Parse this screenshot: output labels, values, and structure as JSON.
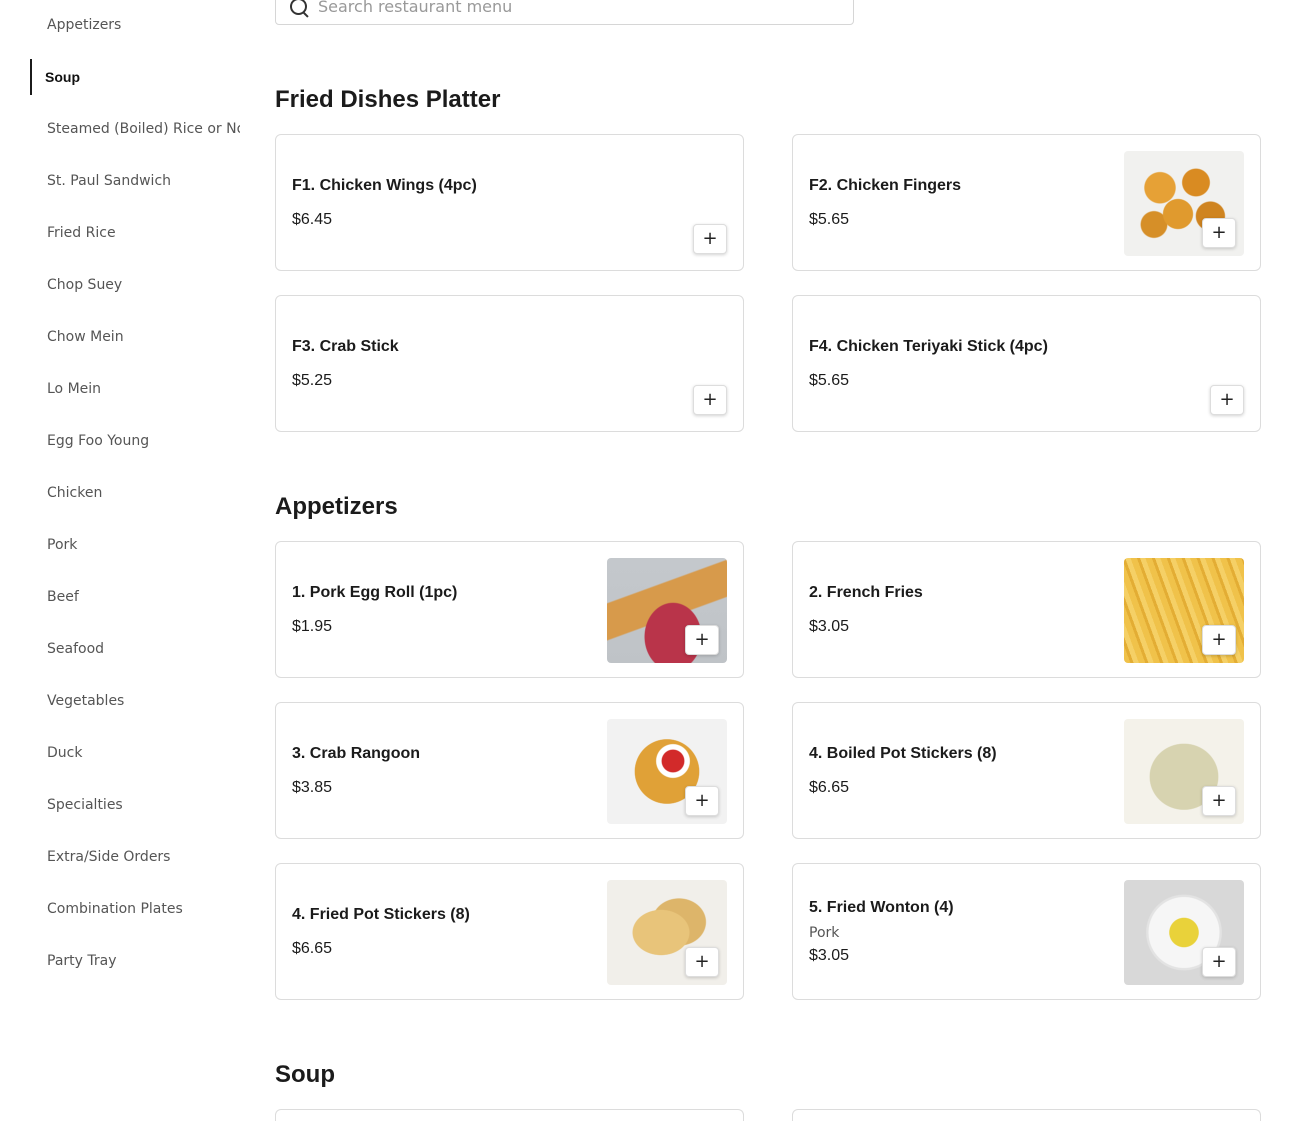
{
  "search": {
    "placeholder": "Search restaurant menu"
  },
  "sidebar": {
    "items": [
      {
        "label": "Appetizers"
      },
      {
        "label": "Soup"
      },
      {
        "label": "Steamed (Boiled) Rice or Noodles"
      },
      {
        "label": "St. Paul Sandwich"
      },
      {
        "label": "Fried Rice"
      },
      {
        "label": "Chop Suey"
      },
      {
        "label": "Chow Mein"
      },
      {
        "label": "Lo Mein"
      },
      {
        "label": "Egg Foo Young"
      },
      {
        "label": "Chicken"
      },
      {
        "label": "Pork"
      },
      {
        "label": "Beef"
      },
      {
        "label": "Seafood"
      },
      {
        "label": "Vegetables"
      },
      {
        "label": "Duck"
      },
      {
        "label": "Specialties"
      },
      {
        "label": "Extra/Side Orders"
      },
      {
        "label": "Combination Plates"
      },
      {
        "label": "Party Tray"
      }
    ],
    "active": "Soup"
  },
  "sections": {
    "fried": {
      "title": "Fried Dishes Platter",
      "items": [
        {
          "name": "F1. Chicken Wings (4pc)",
          "price": "$6.45"
        },
        {
          "name": "F2. Chicken Fingers",
          "price": "$5.65"
        },
        {
          "name": "F3. Crab Stick",
          "price": "$5.25"
        },
        {
          "name": "F4. Chicken Teriyaki Stick (4pc)",
          "price": "$5.65"
        }
      ]
    },
    "appetizers": {
      "title": "Appetizers",
      "items": [
        {
          "name": "1. Pork Egg Roll (1pc)",
          "price": "$1.95"
        },
        {
          "name": "2. French Fries",
          "price": "$3.05"
        },
        {
          "name": "3. Crab Rangoon",
          "price": "$3.85"
        },
        {
          "name": "4. Boiled Pot Stickers (8)",
          "price": "$6.65"
        },
        {
          "name": "4. Fried Pot Stickers (8)",
          "price": "$6.65"
        },
        {
          "name": "5. Fried Wonton (4)",
          "desc": "Pork",
          "price": "$3.05"
        }
      ]
    },
    "soup": {
      "title": "Soup"
    }
  },
  "add_label": "+"
}
